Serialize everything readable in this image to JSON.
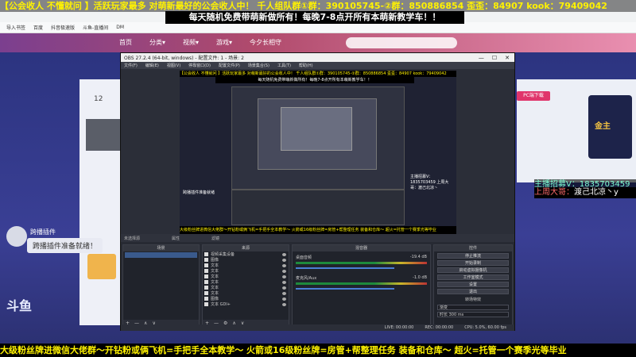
{
  "overlay": {
    "top_banner": "【公会收人 不懂就问 】活跃玩家最多 对萌新最好的公会收人中！ 千人组队群①群：390105745-②群：850886854 歪歪：84907 kook：79409042",
    "sub_banner": "每天随机免费带萌新做所有！每晚7-8点开所有本萌新教学车！！",
    "bottom_banner": "大级粉丝牌进微信大佬群～开钻粉或俩飞机=手把手全本教学～ 火箭或16级粉丝牌=房管+帮整理任务 装备和仓库～ 超火=托管一个赛季光等毕业",
    "recruit": "主播招募V：1835703459",
    "top_week_label": "上周大哥：",
    "top_week_name": "渡己北凉丶y"
  },
  "background_page": {
    "bookmarks": [
      "导入书签",
      "百度",
      "抖音极速版",
      "斗鱼-直播间",
      "DM"
    ],
    "nav_items": [
      "首页",
      "分类▾",
      "视频▾",
      "游戏▾",
      "今夕长相守"
    ],
    "left_counter": "12",
    "pc_badge": "PC端下载",
    "right_deco_text": "金主",
    "logo": "斗鱼"
  },
  "plugin_chat": {
    "name": "跨播插件",
    "message": "跨播插件准备就绪！"
  },
  "obs": {
    "title": "OBS 27.2.4 (64-bit, windows) - 配置文件: 1 - 场景: 2",
    "menu": [
      "文件(F)",
      "编辑(E)",
      "视图(V)",
      "停靠窗口(D)",
      "配置文件(P)",
      "场景集合(S)",
      "工具(T)",
      "帮助(H)"
    ],
    "window_controls": [
      "—",
      "☐",
      "✕"
    ],
    "preview": {
      "banner": "【公会收人 不懂就问 】活跃玩家最多 对萌新最好的公会收人中！ 千人组队群①群：390105745-②群：850886854 歪歪：84907 kook：79409042",
      "sub_banner": "每天随机免费带萌新做所有！每晚7-8点开所有本萌新教学车！！",
      "bottom_banner": "大级粉丝牌进微信大佬群～开钻粉或俩飞机=手把手全本教学～ 火箭或16级粉丝牌=房管+帮整理任务 装备和仓库～ 超火=托管一个赛季光等毕业",
      "plugin_text": "跨播插件准备就绪",
      "right_text": "主播招募V：1835703459 上周大哥：渡己北凉丶"
    },
    "scene_row": [
      "未选择源",
      "属性",
      "滤镜"
    ],
    "docks": {
      "scenes_title": "场景",
      "sources_title": "来源",
      "mixer_title": "混音器",
      "controls_title": "控件"
    },
    "sources": [
      "视频采集设备",
      "图像",
      "文本",
      "文本",
      "文本",
      "文本",
      "文本",
      "文本",
      "图像",
      "文本 GDI+"
    ],
    "mixer": [
      {
        "name": "桌面音频",
        "level": "-19.4 dB"
      },
      {
        "name": "麦克风/Aux",
        "level": "-1.0 dB"
      }
    ],
    "controls": [
      "停止推流",
      "开始录制",
      "启动虚拟摄像机",
      "工作室模式",
      "设置",
      "退出"
    ],
    "transition_label": "转场特效",
    "transition_value": "渐变",
    "duration_label": "时长",
    "duration_value": "300 ms",
    "status": [
      "LIVE: 00:00:00",
      "REC: 00:00:00",
      "CPU: 5.0%, 60.00 fps"
    ]
  }
}
